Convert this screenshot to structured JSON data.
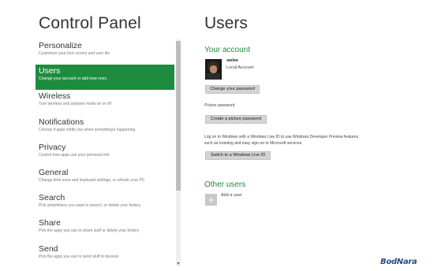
{
  "left_panel": {
    "title": "Control Panel"
  },
  "nav": {
    "items": [
      {
        "label": "Personalize",
        "desc": "Customize your lock screen and user tile"
      },
      {
        "label": "Users",
        "desc": "Change your account or add new ones."
      },
      {
        "label": "Wireless",
        "desc": "Turn wireless and airplane mode on or off"
      },
      {
        "label": "Notifications",
        "desc": "Choose if apps notify you when something's happening."
      },
      {
        "label": "Privacy",
        "desc": "Control how apps use your personal info"
      },
      {
        "label": "General",
        "desc": "Change time zone and keyboard settings, or refresh your PC"
      },
      {
        "label": "Search",
        "desc": "Pick what/where you want to search, or delete your history"
      },
      {
        "label": "Share",
        "desc": "Pick the apps you use to share stuff or delete your history"
      },
      {
        "label": "Send",
        "desc": "Pick the apps you use to send stuff to devices"
      }
    ],
    "selected_index": 1
  },
  "scrollbar": {
    "arrow_icon": "▾"
  },
  "main": {
    "title": "Users",
    "your_account": {
      "heading": "Your account",
      "user_name": "swlee",
      "account_type": "Local Account",
      "change_password_label": "Change your password",
      "picture_password_heading": "Picture password",
      "create_picture_password_label": "Create a picture password",
      "live_id_text_line1": "Log on to Windows with a Windows Live ID to use Windows Developer Preview features",
      "live_id_text_line2": "such as roaming and easy sign-on to Microsoft services.",
      "switch_live_id_label": "Switch to a Windows Live ID"
    },
    "other_users": {
      "heading": "Other users",
      "add_user_icon": "+",
      "add_user_label": "Add a user"
    }
  },
  "watermark": "BodNara",
  "colors": {
    "accent": "#1e8c3f",
    "background": "#ffffff",
    "button": "#d4d4d4"
  }
}
